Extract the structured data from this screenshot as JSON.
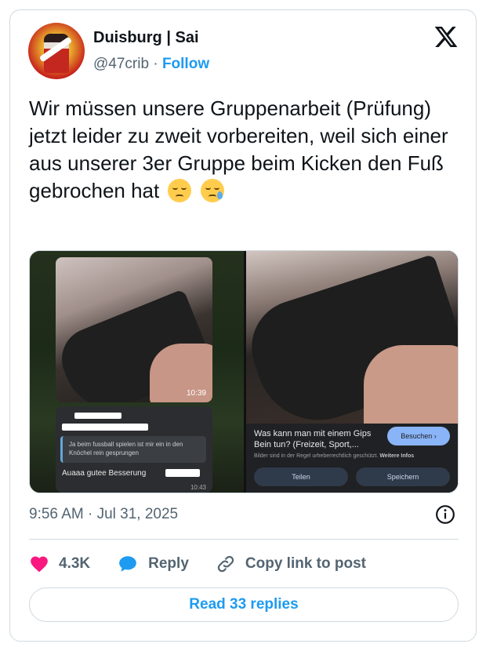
{
  "author": {
    "display_name": "Duisburg | Sai",
    "handle": "@47crib",
    "follow_label": "Follow",
    "separator": "·"
  },
  "tweet": {
    "text": "Wir müssen unsere Gruppenarbeit (Prüfung) jetzt leider zu zweit vorbereiten, weil sich einer aus unserer 3er Gruppe beim Kicken den Fuß gebrochen hat",
    "emojis": [
      "pensive-face-emoji",
      "sleepy-face-emoji"
    ],
    "timestamp": "9:56 AM · Jul 31, 2025"
  },
  "media": {
    "left": {
      "photo_time": "10:39",
      "quoted_message": "Ja beim fussball spielen ist mir ein in den Knöchel rein gesprungen",
      "message": "Auaaa gutee Besserung",
      "message_time": "10:43"
    },
    "right": {
      "google_question": "Was kann man mit einem Gips Bein tun? (Freizeit, Sport,...",
      "search_label": "Besuchen ›",
      "copyright_text": "Bilder sind in der Regel urheberrechtlich geschützt.",
      "more_info": "Weitere Infos",
      "share_label": "Teilen",
      "save_label": "Speichern"
    }
  },
  "actions": {
    "likes": "4.3K",
    "reply": "Reply",
    "copy_link": "Copy link to post"
  },
  "read_replies": "Read 33 replies",
  "colors": {
    "accent": "#1d9bf0",
    "like": "#f91880",
    "text": "#0f1419",
    "muted": "#536471",
    "border": "#cfd9de"
  }
}
